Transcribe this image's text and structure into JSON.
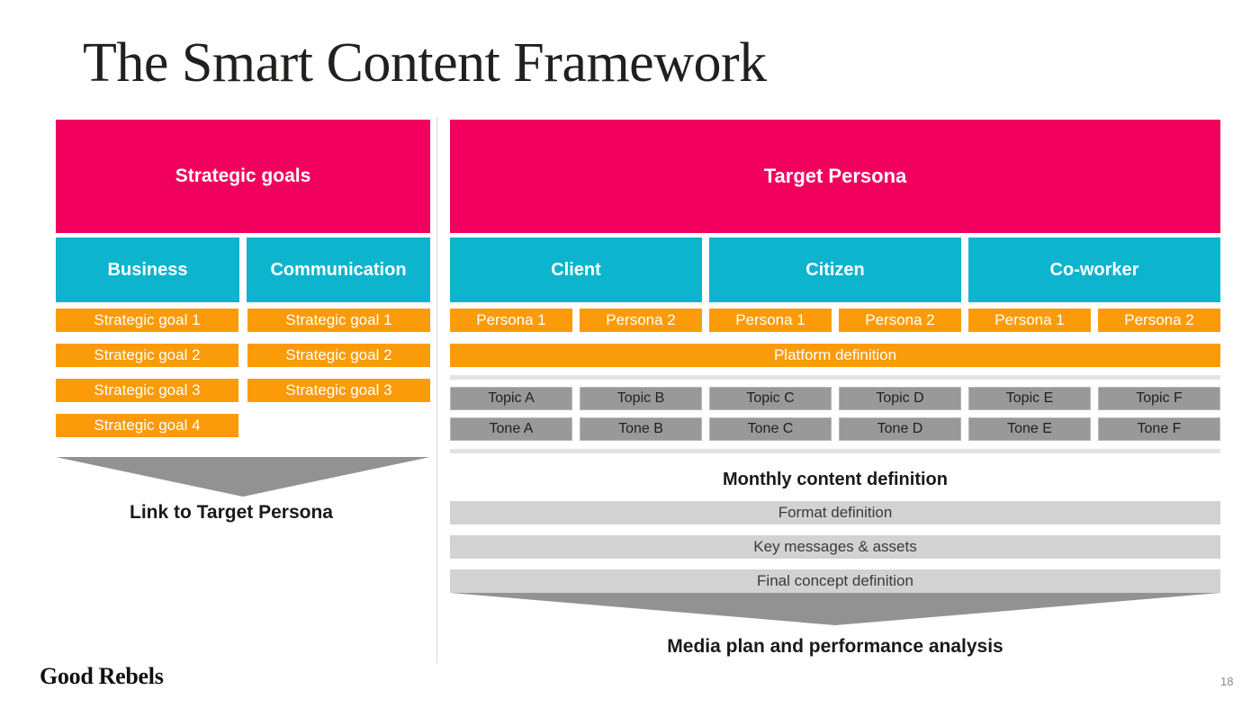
{
  "slide": {
    "title": "The Smart Content Framework",
    "page_number": "18",
    "logo": "Good Rebels",
    "accent_colors": {
      "pink": "#F2005E",
      "teal": "#0CB4CE",
      "orange": "#FB9B0A",
      "gray_chip": "#999999",
      "gray_bar": "#D2D2D2",
      "arrow": "#929292"
    }
  },
  "left_panel": {
    "banner": "Strategic goals",
    "categories": [
      "Business",
      "Communication"
    ],
    "goals": [
      [
        "Strategic goal 1",
        "Strategic goal 1"
      ],
      [
        "Strategic goal 2",
        "Strategic goal 2"
      ],
      [
        "Strategic goal 3",
        "Strategic goal 3"
      ],
      [
        "Strategic goal 4",
        ""
      ]
    ],
    "arrow_caption": "Link to Target Persona"
  },
  "right_panel": {
    "banner": "Target Persona",
    "categories": [
      "Client",
      "Citizen",
      "Co-worker"
    ],
    "personas": [
      "Persona 1",
      "Persona 2",
      "Persona 1",
      "Persona 2",
      "Persona 1",
      "Persona 2"
    ],
    "platform_bar": "Platform definition",
    "topics": [
      "Topic A",
      "Topic B",
      "Topic C",
      "Topic D",
      "Topic E",
      "Topic F"
    ],
    "tones": [
      "Tone A",
      "Tone B",
      "Tone C",
      "Tone D",
      "Tone E",
      "Tone F"
    ],
    "monthly_heading": "Monthly content definition",
    "definition_bars": [
      "Format definition",
      "Key messages & assets",
      "Final concept definition"
    ],
    "arrow_caption": "Media plan and performance analysis"
  }
}
